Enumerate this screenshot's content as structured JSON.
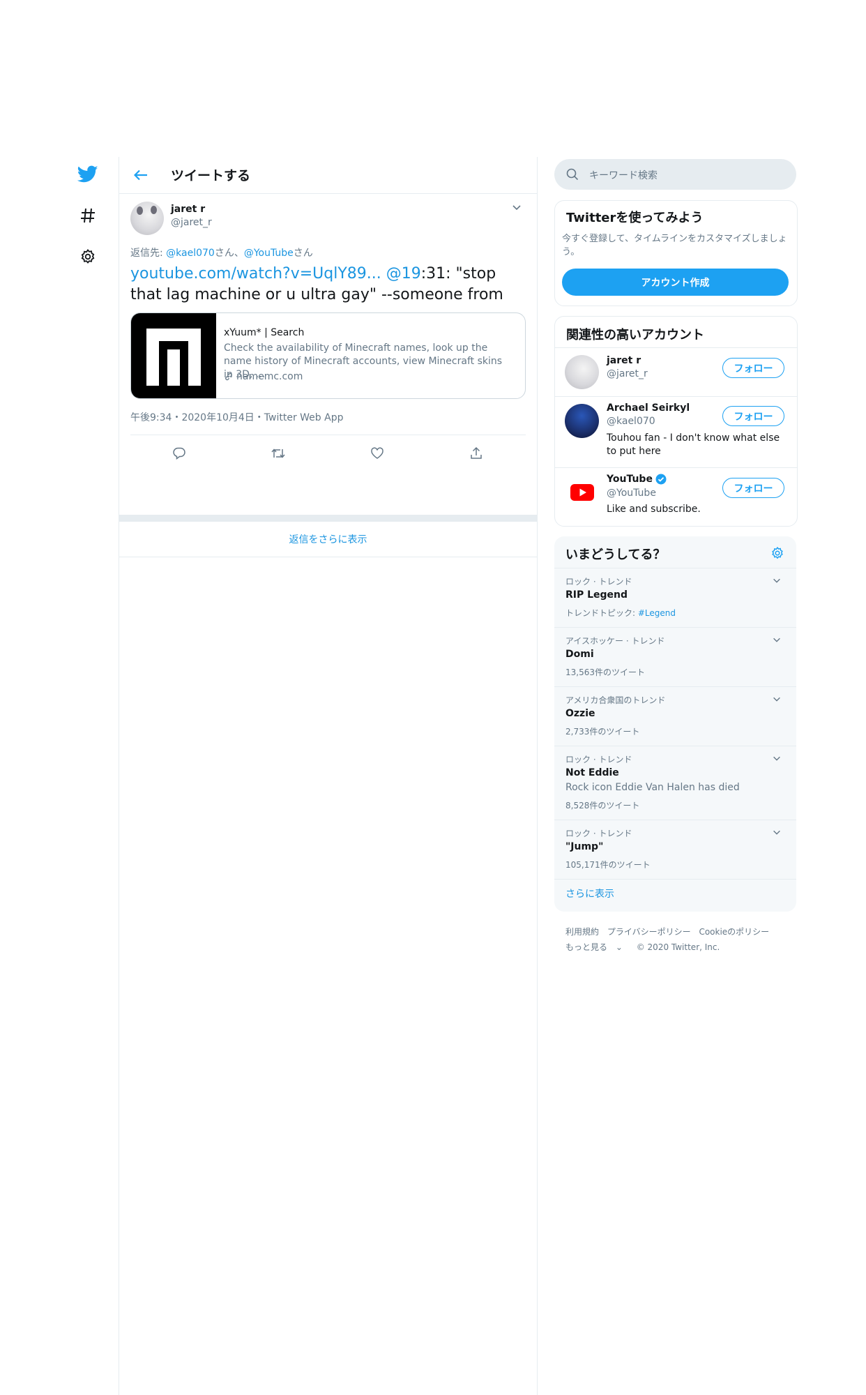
{
  "colors": {
    "accent": "#1da1f2",
    "link": "#1b95e0",
    "text": "#14171a",
    "muted": "#657786",
    "border": "#e6ecf0"
  },
  "nav": {
    "items": [
      "twitter-logo-icon",
      "hashtag-icon",
      "settings-icon"
    ]
  },
  "header": {
    "title": "ツイートする"
  },
  "tweet": {
    "name": "jaret r",
    "handle": "@jaret_r",
    "reply_prefix": "返信先: ",
    "reply_user1": "@kael070",
    "reply_san1": "さん、",
    "reply_user2": "@YouTube",
    "reply_san2": "さん",
    "text_link": "youtube.com/watch?v=UqlY89...",
    "text_mention": "@19",
    "text_rest": ":31: \"stop that lag machine or u ultra gay\" --someone from",
    "card": {
      "title": "xYuum* | Search",
      "description": "Check the availability of Minecraft names, look up the name history of Minecraft accounts, view Minecraft skins in 3D, ...",
      "domain": "namemc.com"
    },
    "meta": "午後9:34・2020年10月4日・Twitter Web App",
    "actions": [
      "reply-icon",
      "retweet-icon",
      "like-icon",
      "share-icon"
    ]
  },
  "show_more_replies": "返信をさらに表示",
  "search": {
    "placeholder": "キーワード検索"
  },
  "signup": {
    "title": "Twitterを使ってみよう",
    "subtitle": "今すぐ登録して、タイムラインをカスタマイズしましょう。",
    "button": "アカウント作成"
  },
  "who_to_follow": {
    "title": "関連性の高いアカウント",
    "follow_label": "フォロー",
    "accounts": [
      {
        "name": "jaret r",
        "handle": "@jaret_r",
        "bio": "",
        "verified": false
      },
      {
        "name": "Archael Seirkyl",
        "handle": "@kael070",
        "bio": "Touhou fan - I don't know what else to put here",
        "verified": false
      },
      {
        "name": "YouTube",
        "handle": "@YouTube",
        "bio": "Like and subscribe.",
        "verified": true
      }
    ]
  },
  "trends": {
    "title": "いまどうしてる？",
    "items": [
      {
        "context": "ロック · トレンド",
        "name": "RIP Legend",
        "extra_prefix": "トレンドトピック: ",
        "extra_link": "#Legend",
        "count": ""
      },
      {
        "context": "アイスホッケー · トレンド",
        "name": "Domi",
        "extra_prefix": "",
        "extra_link": "",
        "count": "13,563件のツイート"
      },
      {
        "context": "アメリカ合衆国のトレンド",
        "name": "Ozzie",
        "extra_prefix": "",
        "extra_link": "",
        "count": "2,733件のツイート"
      },
      {
        "context": "ロック · トレンド",
        "name": "Not Eddie",
        "extra_prefix": "Rock icon Eddie Van Halen has died",
        "extra_link": "",
        "count": "8,528件のツイート"
      },
      {
        "context": "ロック · トレンド",
        "name": "\"Jump\"",
        "extra_prefix": "",
        "extra_link": "",
        "count": "105,171件のツイート"
      }
    ],
    "show_more": "さらに表示"
  },
  "footer": {
    "terms": "利用規約",
    "privacy": "プライバシーポリシー",
    "cookies": "Cookieのポリシー",
    "more": "もっと見る",
    "copyright": "© 2020 Twitter, Inc."
  }
}
